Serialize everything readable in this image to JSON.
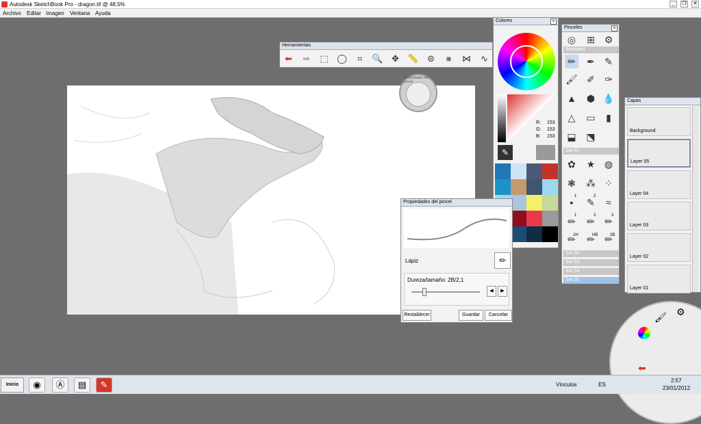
{
  "window": {
    "title": "Autodesk SketchBook Pro - dragon.tif @ 48,5%"
  },
  "menu": [
    "Archivo",
    "Editar",
    "Imagen",
    "Ventana",
    "Ayuda"
  ],
  "tools_panel": {
    "title": "Herramientas",
    "puck_label": "Propiedades del pincel"
  },
  "colors_panel": {
    "title": "Colores",
    "rgb": {
      "r_label": "R:",
      "r": "153",
      "g_label": "G:",
      "g": "153",
      "b_label": "B:",
      "b": "153"
    },
    "swatches": [
      "#1f78b4",
      "#cfe4f3",
      "#4a5a74",
      "#c4322a",
      "#1a93c9",
      "#c49a6c",
      "#3f5570",
      "#9ed8ef",
      "#9ad9e8",
      "#a9c6e0",
      "#f3f06a",
      "#c4d99a",
      "#4c5264",
      "#8e0e1e",
      "#e9394c",
      "#9a9a9a",
      "#1aa6e8",
      "#1c4d77",
      "#0e2e47",
      "#000000"
    ]
  },
  "brushes_panel": {
    "title": "Pinceles",
    "sets": [
      "Standard",
      "Set 01",
      "Set 02",
      "Set 03",
      "Set 04",
      "Set 05"
    ],
    "numbers": [
      "1",
      "2",
      "1",
      "2",
      "3",
      "2H",
      "HB",
      "2B"
    ]
  },
  "layers_panel": {
    "title": "Capas",
    "layers": [
      "Background",
      "Layer 05",
      "Layer 04",
      "Layer 03",
      "Layer 02",
      "Layer 01"
    ]
  },
  "brush_props": {
    "title": "Propiedades del pincel",
    "brush_name": "Lápiz",
    "slider_label": "Dureza/tamaño: 2B/2,1",
    "reset": "Restablecer",
    "save": "Guardar",
    "cancel": "Cancelar"
  },
  "taskbar": {
    "start": "Inicio",
    "links": "Vínculos",
    "lang": "ES",
    "time": "2:57",
    "date": "23/01/2012"
  },
  "colors": {
    "accent": "#d6352a",
    "panel_head": "#dde4ee"
  }
}
